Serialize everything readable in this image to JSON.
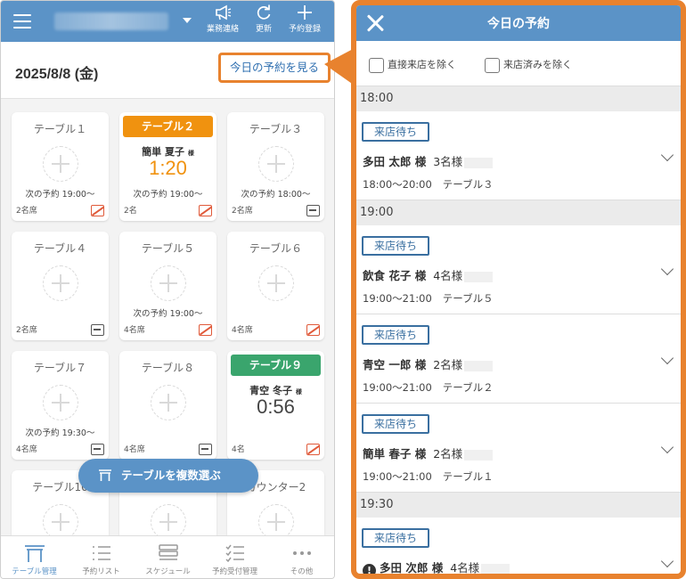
{
  "left": {
    "topbar": {
      "actions": [
        {
          "label": "業務連絡",
          "icon": "megaphone-icon"
        },
        {
          "label": "更新",
          "icon": "refresh-icon"
        },
        {
          "label": "予約登録",
          "icon": "plus-icon"
        }
      ]
    },
    "date": "2025/8/8 (金)",
    "see_link": "今日の予約を見る",
    "tables": [
      {
        "name": "テーブル１",
        "next": "次の予約 19:00～",
        "seats": "2名席",
        "badge": "smoke-no"
      },
      {
        "name": "テーブル２",
        "header_color": "#f0920f",
        "guest": "簡単 夏子",
        "honorific": "様",
        "timer": "1:20",
        "timer_color": "#f0920f",
        "next": "次の予約 19:00～",
        "seats": "2名",
        "badge": "smoke-no"
      },
      {
        "name": "テーブル３",
        "next": "次の予約 18:00～",
        "seats": "2名席",
        "badge": "smoke-ok"
      },
      {
        "name": "テーブル４",
        "seats": "2名席",
        "badge": "smoke-ok"
      },
      {
        "name": "テーブル５",
        "next": "次の予約 19:00～",
        "seats": "4名席",
        "badge": "smoke-no"
      },
      {
        "name": "テーブル６",
        "seats": "4名席",
        "badge": "smoke-no"
      },
      {
        "name": "テーブル７",
        "next": "次の予約 19:30～",
        "seats": "4名席",
        "badge": "smoke-ok"
      },
      {
        "name": "テーブル８",
        "seats": "4名席",
        "badge": "smoke-ok"
      },
      {
        "name": "テーブル９",
        "header_color": "#3aa56d",
        "guest": "青空 冬子",
        "honorific": "様",
        "timer": "0:56",
        "timer_color": "#444444",
        "seats": "4名",
        "badge": "smoke-no"
      },
      {
        "name": "テーブル10"
      },
      {
        "name": ""
      },
      {
        "name": "カウンター2"
      }
    ],
    "multi_select_button": "テーブルを複数選ぶ",
    "nav": [
      {
        "label": "テーブル管理",
        "icon": "table-icon",
        "active": true
      },
      {
        "label": "予約リスト",
        "icon": "list-icon"
      },
      {
        "label": "スケジュール",
        "icon": "schedule-icon"
      },
      {
        "label": "予約受付管理",
        "icon": "checklist-icon"
      },
      {
        "label": "その他",
        "icon": "more-icon"
      }
    ]
  },
  "panel": {
    "title": "今日の予約",
    "filters": [
      "直接来店を除く",
      "来店済みを除く"
    ],
    "groups": [
      {
        "time": "18:00",
        "items": [
          {
            "status": "来店待ち",
            "name": "多田 太郎 様",
            "party": "3名様",
            "time": "18:00～20:00",
            "table": "テーブル３"
          }
        ]
      },
      {
        "time": "19:00",
        "items": [
          {
            "status": "来店待ち",
            "name": "飲食 花子 様",
            "party": "4名様",
            "time": "19:00～21:00",
            "table": "テーブル５"
          },
          {
            "status": "来店待ち",
            "name": "青空 一郎 様",
            "party": "2名様",
            "time": "19:00～21:00",
            "table": "テーブル２"
          },
          {
            "status": "来店待ち",
            "name": "簡単 春子 様",
            "party": "2名様",
            "time": "19:00～21:00",
            "table": "テーブル１"
          }
        ]
      },
      {
        "time": "19:30",
        "items": [
          {
            "status": "来店待ち",
            "name": "多田 次郎 様",
            "party": "4名様",
            "alert": true
          }
        ]
      }
    ]
  },
  "colors": {
    "primary": "#5b93c7",
    "accent": "#e8822e"
  }
}
